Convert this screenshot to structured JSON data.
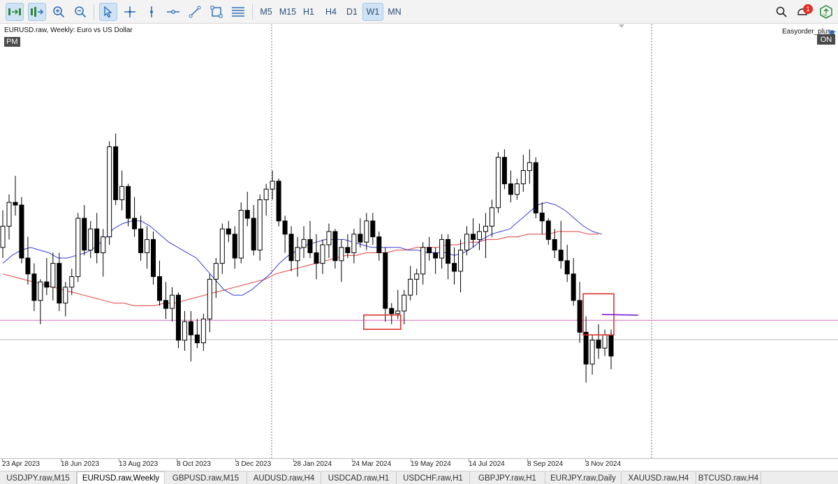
{
  "toolbar": {
    "icons": [
      "autoscroll-icon",
      "chart-shift-icon",
      "zoom-in-icon",
      "zoom-out-icon",
      "cursor-icon",
      "crosshair-icon",
      "vertical-line-icon",
      "horizontal-line-icon",
      "trendline-icon",
      "rectangle-icon",
      "fibonacci-icon"
    ],
    "timeframes": [
      "M5",
      "M15",
      "H1",
      "H4",
      "D1",
      "W1",
      "MN"
    ],
    "active_timeframe": "W1",
    "notification_count": "1"
  },
  "chart": {
    "title": "EURUSD.raw, Weekly:  Euro vs US Dollar",
    "pm_badge": "PM",
    "ea_name": "Easyorder_plus",
    "ea_status": "ON",
    "colors": {
      "bull_body": "#ffffff",
      "bear_body": "#000000",
      "ma_fast": "#3b3bd6",
      "ma_slow": "#e0403a",
      "highlight_box": "#e0322b",
      "level_line": "#d070b8",
      "segment_line": "#7a1fd6"
    }
  },
  "chart_data": {
    "type": "candlestick",
    "x_labels": [
      "23 Apr 2023",
      "18 Jun 2023",
      "13 Aug 2023",
      "8 Oct 2023",
      "3 Dec 2023",
      "28 Jan 2024",
      "24 Mar 2024",
      "19 May 2024",
      "14 Jul 2024",
      "8 Sep 2024",
      "3 Nov 2024"
    ],
    "candles": [
      [
        1.084,
        1.098,
        1.08,
        1.092
      ],
      [
        1.092,
        1.104,
        1.087,
        1.101
      ],
      [
        1.101,
        1.111,
        1.096,
        1.1
      ],
      [
        1.1,
        1.103,
        1.078,
        1.08
      ],
      [
        1.08,
        1.088,
        1.07,
        1.074
      ],
      [
        1.074,
        1.078,
        1.06,
        1.064
      ],
      [
        1.064,
        1.072,
        1.055,
        1.071
      ],
      [
        1.071,
        1.08,
        1.066,
        1.069
      ],
      [
        1.069,
        1.082,
        1.064,
        1.078
      ],
      [
        1.078,
        1.082,
        1.06,
        1.063
      ],
      [
        1.063,
        1.071,
        1.058,
        1.069
      ],
      [
        1.069,
        1.076,
        1.066,
        1.073
      ],
      [
        1.073,
        1.097,
        1.071,
        1.095
      ],
      [
        1.095,
        1.1,
        1.081,
        1.083
      ],
      [
        1.083,
        1.094,
        1.08,
        1.091
      ],
      [
        1.091,
        1.097,
        1.078,
        1.082
      ],
      [
        1.082,
        1.091,
        1.073,
        1.088
      ],
      [
        1.088,
        1.124,
        1.085,
        1.122
      ],
      [
        1.122,
        1.127,
        1.1,
        1.102
      ],
      [
        1.102,
        1.113,
        1.098,
        1.107
      ],
      [
        1.107,
        1.108,
        1.092,
        1.095
      ],
      [
        1.095,
        1.103,
        1.088,
        1.091
      ],
      [
        1.091,
        1.096,
        1.079,
        1.082
      ],
      [
        1.082,
        1.092,
        1.076,
        1.087
      ],
      [
        1.087,
        1.09,
        1.07,
        1.073
      ],
      [
        1.073,
        1.079,
        1.062,
        1.064
      ],
      [
        1.064,
        1.071,
        1.057,
        1.061
      ],
      [
        1.061,
        1.069,
        1.056,
        1.066
      ],
      [
        1.066,
        1.067,
        1.046,
        1.049
      ],
      [
        1.049,
        1.06,
        1.045,
        1.056
      ],
      [
        1.056,
        1.06,
        1.041,
        1.051
      ],
      [
        1.051,
        1.057,
        1.046,
        1.048
      ],
      [
        1.048,
        1.059,
        1.045,
        1.057
      ],
      [
        1.057,
        1.074,
        1.052,
        1.072
      ],
      [
        1.072,
        1.08,
        1.065,
        1.078
      ],
      [
        1.078,
        1.093,
        1.074,
        1.091
      ],
      [
        1.091,
        1.094,
        1.086,
        1.089
      ],
      [
        1.089,
        1.092,
        1.076,
        1.08
      ],
      [
        1.08,
        1.101,
        1.078,
        1.098
      ],
      [
        1.098,
        1.105,
        1.092,
        1.095
      ],
      [
        1.095,
        1.1,
        1.081,
        1.083
      ],
      [
        1.083,
        1.104,
        1.079,
        1.102
      ],
      [
        1.102,
        1.108,
        1.096,
        1.106
      ],
      [
        1.106,
        1.113,
        1.102,
        1.109
      ],
      [
        1.109,
        1.11,
        1.092,
        1.094
      ],
      [
        1.094,
        1.096,
        1.082,
        1.089
      ],
      [
        1.089,
        1.092,
        1.075,
        1.079
      ],
      [
        1.079,
        1.088,
        1.073,
        1.084
      ],
      [
        1.084,
        1.092,
        1.08,
        1.087
      ],
      [
        1.087,
        1.094,
        1.08,
        1.082
      ],
      [
        1.082,
        1.089,
        1.072,
        1.078
      ],
      [
        1.078,
        1.087,
        1.074,
        1.085
      ],
      [
        1.085,
        1.093,
        1.08,
        1.09
      ],
      [
        1.09,
        1.091,
        1.076,
        1.079
      ],
      [
        1.079,
        1.087,
        1.071,
        1.084
      ],
      [
        1.084,
        1.089,
        1.08,
        1.082
      ],
      [
        1.082,
        1.091,
        1.078,
        1.089
      ],
      [
        1.089,
        1.095,
        1.084,
        1.086
      ],
      [
        1.086,
        1.097,
        1.083,
        1.094
      ],
      [
        1.094,
        1.097,
        1.085,
        1.088
      ],
      [
        1.088,
        1.09,
        1.079,
        1.082
      ],
      [
        1.082,
        1.084,
        1.056,
        1.061
      ],
      [
        1.061,
        1.063,
        1.055,
        1.059
      ],
      [
        1.059,
        1.068,
        1.057,
        1.06
      ],
      [
        1.06,
        1.068,
        1.055,
        1.066
      ],
      [
        1.066,
        1.077,
        1.064,
        1.072
      ],
      [
        1.072,
        1.076,
        1.066,
        1.074
      ],
      [
        1.074,
        1.086,
        1.07,
        1.084
      ],
      [
        1.084,
        1.088,
        1.079,
        1.082
      ],
      [
        1.082,
        1.084,
        1.074,
        1.08
      ],
      [
        1.08,
        1.089,
        1.076,
        1.087
      ],
      [
        1.087,
        1.089,
        1.072,
        1.078
      ],
      [
        1.078,
        1.084,
        1.07,
        1.075
      ],
      [
        1.075,
        1.087,
        1.067,
        1.083
      ],
      [
        1.083,
        1.092,
        1.081,
        1.089
      ],
      [
        1.089,
        1.095,
        1.084,
        1.087
      ],
      [
        1.087,
        1.093,
        1.083,
        1.09
      ],
      [
        1.09,
        1.097,
        1.08,
        1.092
      ],
      [
        1.092,
        1.102,
        1.088,
        1.099
      ],
      [
        1.099,
        1.12,
        1.097,
        1.118
      ],
      [
        1.118,
        1.121,
        1.106,
        1.108
      ],
      [
        1.108,
        1.113,
        1.101,
        1.104
      ],
      [
        1.104,
        1.11,
        1.102,
        1.108
      ],
      [
        1.108,
        1.119,
        1.105,
        1.113
      ],
      [
        1.113,
        1.121,
        1.108,
        1.116
      ],
      [
        1.116,
        1.118,
        1.095,
        1.097
      ],
      [
        1.097,
        1.101,
        1.089,
        1.094
      ],
      [
        1.094,
        1.095,
        1.085,
        1.087
      ],
      [
        1.087,
        1.091,
        1.08,
        1.083
      ],
      [
        1.083,
        1.094,
        1.076,
        1.079
      ],
      [
        1.079,
        1.085,
        1.071,
        1.074
      ],
      [
        1.074,
        1.08,
        1.062,
        1.064
      ],
      [
        1.064,
        1.071,
        1.048,
        1.052
      ],
      [
        1.052,
        1.058,
        1.033,
        1.04
      ],
      [
        1.04,
        1.051,
        1.036,
        1.049
      ],
      [
        1.049,
        1.055,
        1.042,
        1.046
      ],
      [
        1.046,
        1.053,
        1.043,
        1.051
      ],
      [
        1.051,
        1.053,
        1.038,
        1.043
      ]
    ],
    "ma_fast": [
      1.078,
      1.081,
      1.083,
      1.084,
      1.083,
      1.082,
      1.08,
      1.08,
      1.081,
      1.082,
      1.084,
      1.087,
      1.091,
      1.093,
      1.094,
      1.094,
      1.092,
      1.089,
      1.086,
      1.084,
      1.082,
      1.08,
      1.076,
      1.072,
      1.068,
      1.066,
      1.066,
      1.068,
      1.071,
      1.074,
      1.078,
      1.081,
      1.083,
      1.085,
      1.086,
      1.087,
      1.087,
      1.087,
      1.086,
      1.085,
      1.084,
      1.084,
      1.084,
      1.084,
      1.083,
      1.083,
      1.082,
      1.082,
      1.082,
      1.081,
      1.082,
      1.084,
      1.087,
      1.089,
      1.09,
      1.091,
      1.094,
      1.097,
      1.1,
      1.101,
      1.1,
      1.098,
      1.095,
      1.092,
      1.09,
      1.089
    ],
    "ma_slow": [
      1.074,
      1.073,
      1.072,
      1.071,
      1.07,
      1.069,
      1.068,
      1.067,
      1.066,
      1.065,
      1.064,
      1.063,
      1.063,
      1.062,
      1.062,
      1.062,
      1.063,
      1.063,
      1.064,
      1.065,
      1.066,
      1.067,
      1.068,
      1.069,
      1.07,
      1.071,
      1.072,
      1.074,
      1.075,
      1.076,
      1.077,
      1.078,
      1.079,
      1.08,
      1.081,
      1.081,
      1.082,
      1.082,
      1.082,
      1.083,
      1.083,
      1.084,
      1.084,
      1.084,
      1.085,
      1.085,
      1.086,
      1.086,
      1.087,
      1.087,
      1.088,
      1.088,
      1.089,
      1.089,
      1.089,
      1.09,
      1.09,
      1.09,
      1.089,
      1.089
    ],
    "horizontal_lines": [
      1.0565,
      1.0492
    ],
    "highlight_boxes": [
      {
        "x_from_index": 58,
        "x_to_index": 63,
        "price_from": 1.0585,
        "price_to": 1.0531
      },
      {
        "x_from_index": 93,
        "x_to_index": 97,
        "price_from": 1.0665,
        "price_to": 1.051
      }
    ],
    "segment_price": 1.0587,
    "grid": false
  },
  "tabs": [
    {
      "label": "USDJPY.raw,M15",
      "active": false
    },
    {
      "label": "EURUSD.raw,Weekly",
      "active": true
    },
    {
      "label": "GBPUSD.raw,M15",
      "active": false
    },
    {
      "label": "AUDUSD.raw,H4",
      "active": false
    },
    {
      "label": "USDCAD.raw,H1",
      "active": false
    },
    {
      "label": "USDCHF.raw,H1",
      "active": false
    },
    {
      "label": "GBPJPY.raw,H1",
      "active": false
    },
    {
      "label": "EURJPY.raw,Daily",
      "active": false
    },
    {
      "label": "XAUUSD.raw,H4",
      "active": false
    },
    {
      "label": "BTCUSD.raw,H4",
      "active": false
    }
  ]
}
